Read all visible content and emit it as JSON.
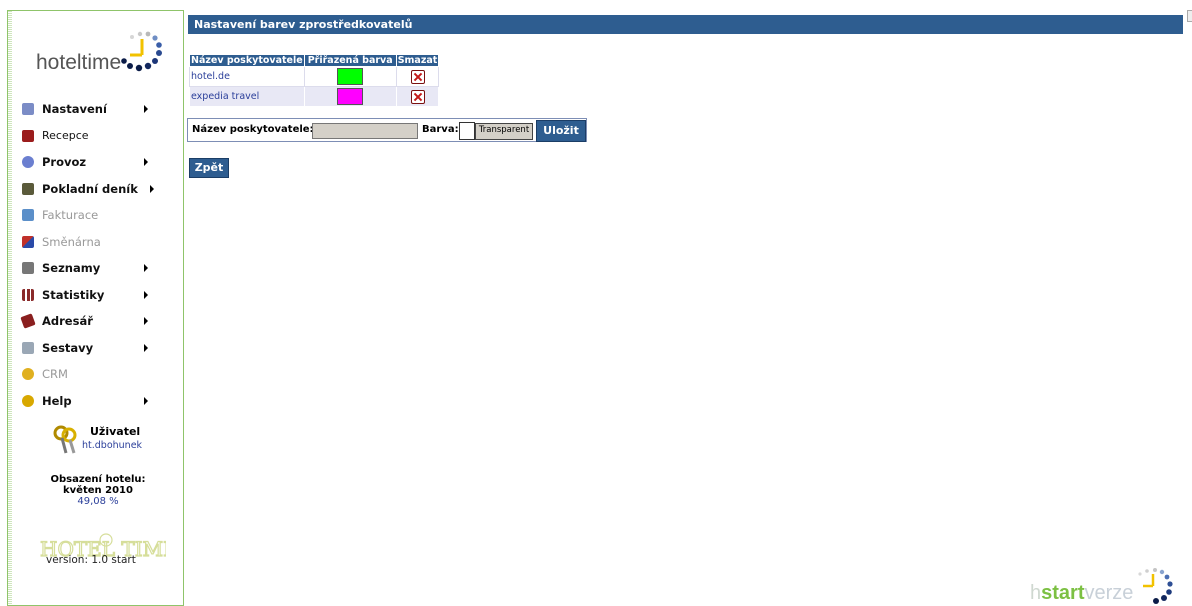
{
  "sidebar": {
    "logo_text": "hoteltime",
    "menu": [
      {
        "label": "Nastavení",
        "icon": "settings-icon",
        "enabled": true,
        "has_submenu": true,
        "color": "#7b8cc6"
      },
      {
        "label": "Recepce",
        "icon": "reception-icon",
        "enabled": true,
        "has_submenu": false,
        "color": "#9b1c1c"
      },
      {
        "label": "Provoz",
        "icon": "gear-icon",
        "enabled": true,
        "has_submenu": true,
        "color": "#6b7fd0"
      },
      {
        "label": "Pokladní deník",
        "icon": "cashbook-icon",
        "enabled": true,
        "has_submenu": true,
        "color": "#5a5a3a"
      },
      {
        "label": "Fakturace",
        "icon": "invoice-icon",
        "enabled": false,
        "has_submenu": false,
        "color": "#5b8fc9"
      },
      {
        "label": "Směnárna",
        "icon": "exchange-icon",
        "enabled": false,
        "has_submenu": false,
        "color": "#c0302a"
      },
      {
        "label": "Seznamy",
        "icon": "list-icon",
        "enabled": true,
        "has_submenu": true,
        "color": "#777777"
      },
      {
        "label": "Statistiky",
        "icon": "statistics-icon",
        "enabled": true,
        "has_submenu": true,
        "color": "#8a2a2a"
      },
      {
        "label": "Adresář",
        "icon": "address-book-icon",
        "enabled": true,
        "has_submenu": true,
        "color": "#8a1f1f"
      },
      {
        "label": "Sestavy",
        "icon": "printer-icon",
        "enabled": true,
        "has_submenu": true,
        "color": "#9aa7b5"
      },
      {
        "label": "CRM",
        "icon": "crm-icon",
        "enabled": false,
        "has_submenu": false,
        "color": "#e0b020"
      },
      {
        "label": "Help",
        "icon": "help-icon",
        "enabled": true,
        "has_submenu": true,
        "color": "#d8a800"
      }
    ],
    "user": {
      "title": "Uživatel",
      "name": "ht.dbohunek"
    },
    "occupancy": {
      "title": "Obsazení hotelu:",
      "period": "květen 2010",
      "value": "49,08 %"
    },
    "bottom_logo_text": "HOTEL TIME",
    "version": "version: 1.0 start"
  },
  "page": {
    "title": "Nastavení barev zprostředkovatelů",
    "table": {
      "headers": [
        "Název poskytovatele",
        "Přiřazená barva",
        "Smazat"
      ],
      "rows": [
        {
          "name": "hotel.de",
          "color": "#00ff00"
        },
        {
          "name": "expedia travel",
          "color": "#ff00ff"
        }
      ]
    },
    "form": {
      "name_label": "Název poskytovatele:",
      "name_value": "",
      "color_label": "Barva:",
      "transparent_label": "Transparent",
      "save_label": "Uložit"
    },
    "back_label": "Zpět"
  },
  "footer_logo": {
    "part1": "h",
    "part2": "start",
    "part3": "verze"
  }
}
